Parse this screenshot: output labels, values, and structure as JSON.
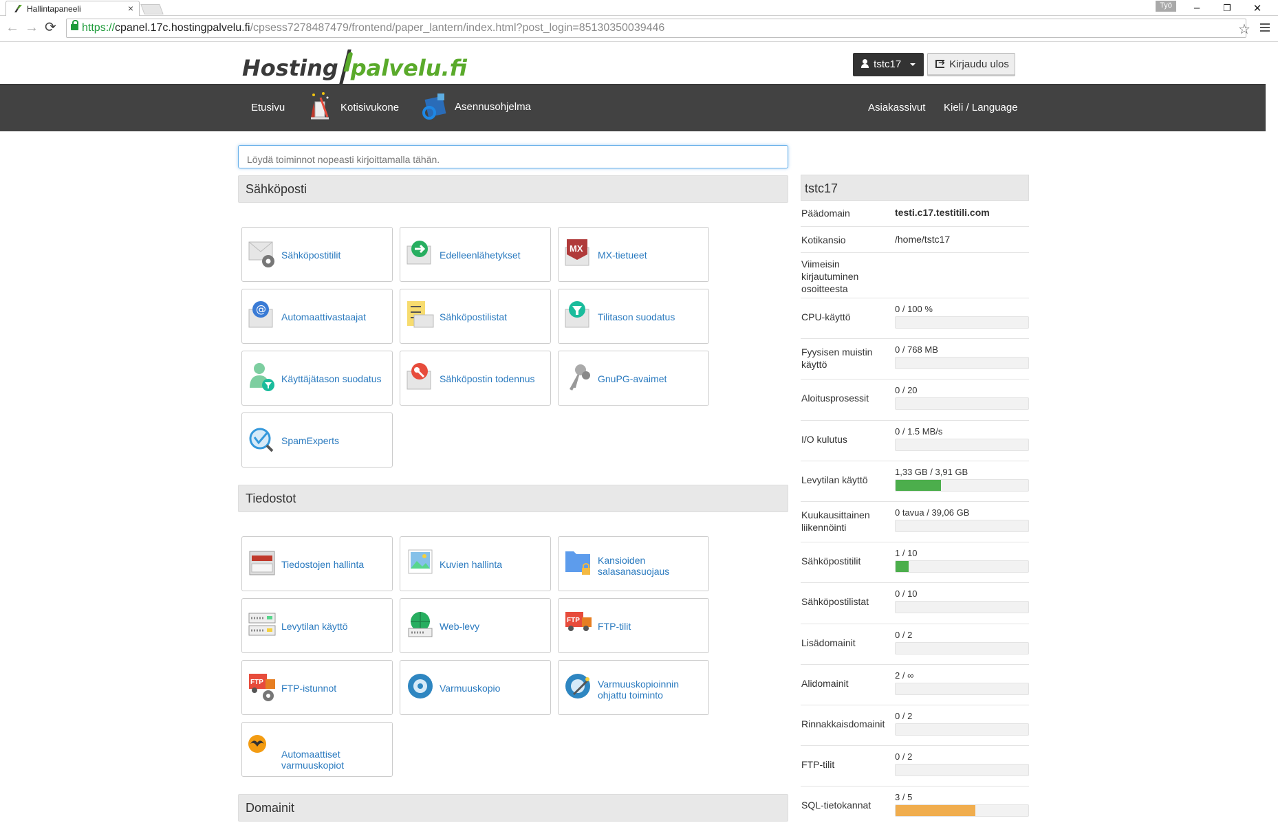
{
  "browser": {
    "tab_title": "Hallintapaneeli",
    "tab_close": "×",
    "window_badge": "Työ",
    "url_scheme": "https://",
    "url_host": "cpanel.17c.hostingpalvelu.fi",
    "url_path": "/cpsess7278487479/frontend/paper_lantern/index.html?post_login=85130350039446",
    "back": "←",
    "forward": "→",
    "reload": "⟳",
    "star": "☆",
    "minimize": "–",
    "restore": "❐",
    "close": "✕"
  },
  "header": {
    "logo_part1": "Hosting",
    "logo_part2": "palvelu.fi",
    "user_label": "tstc17",
    "logout_label": "Kirjaudu ulos"
  },
  "nav": {
    "home": "Etusivu",
    "site_builder": "Kotisivukone",
    "installer": "Asennusohjelma",
    "customer_pages": "Asiakassivut",
    "language": "Kieli / Language"
  },
  "search": {
    "placeholder": "Löydä toiminnot nopeasti kirjoittamalla tähän."
  },
  "sections": {
    "email": {
      "title": "Sähköposti",
      "items": [
        {
          "label": "Sähköpostitilit",
          "icon": "email-accounts-icon"
        },
        {
          "label": "Edelleenlähetykset",
          "icon": "forwarders-icon"
        },
        {
          "label": "MX-tietueet",
          "icon": "mx-records-icon"
        },
        {
          "label": "Automaattivastaajat",
          "icon": "autoresponders-icon"
        },
        {
          "label": "Sähköpostilistat",
          "icon": "mailing-lists-icon"
        },
        {
          "label": "Tilitason suodatus",
          "icon": "account-filter-icon"
        },
        {
          "label": "Käyttäjätason suodatus",
          "icon": "user-filter-icon"
        },
        {
          "label": "Sähköpostin todennus",
          "icon": "email-auth-icon"
        },
        {
          "label": "GnuPG-avaimet",
          "icon": "gnupg-keys-icon"
        },
        {
          "label": "SpamExperts",
          "icon": "spamexperts-icon"
        }
      ]
    },
    "files": {
      "title": "Tiedostot",
      "items": [
        {
          "label": "Tiedostojen hallinta",
          "icon": "file-manager-icon"
        },
        {
          "label": "Kuvien hallinta",
          "icon": "images-icon"
        },
        {
          "label": "Kansioiden",
          "label2": "salasanasuojaus",
          "icon": "folder-lock-icon"
        },
        {
          "label": "Levytilan käyttö",
          "icon": "disk-usage-icon"
        },
        {
          "label": "Web-levy",
          "icon": "web-disk-icon"
        },
        {
          "label": "FTP-tilit",
          "icon": "ftp-accounts-icon"
        },
        {
          "label": "FTP-istunnot",
          "icon": "ftp-sessions-icon"
        },
        {
          "label": "Varmuuskopio",
          "icon": "backup-icon"
        },
        {
          "label": "Varmuuskopioinnin",
          "label2": "ohjattu toiminto",
          "icon": "backup-wizard-icon"
        },
        {
          "label": "Automaattiset",
          "label2": "varmuuskopiot",
          "icon": "auto-backup-icon"
        }
      ]
    },
    "domains": {
      "title": "Domainit"
    }
  },
  "sidebar": {
    "title": "tstc17",
    "info": [
      {
        "key": "Päädomain",
        "value": "testi.c17.testitili.com"
      },
      {
        "key": "Kotikansio",
        "value": "/home/tstc17"
      },
      {
        "key": "Viimeisin",
        "key2": "kirjautuminen",
        "key3": "osoitteesta",
        "value": ""
      }
    ],
    "stats": [
      {
        "key": "CPU-käyttö",
        "value": "0 / 100 %",
        "percent": 0
      },
      {
        "key": "Fyysisen muistin",
        "key2": "käyttö",
        "value": "0 / 768 MB",
        "percent": 0
      },
      {
        "key": "Aloitusprosessit",
        "value": "0 / 20",
        "percent": 0
      },
      {
        "key": "I/O kulutus",
        "value": "0 / 1.5 MB/s",
        "percent": 0
      },
      {
        "key": "Levytilan käyttö",
        "value": "1,33 GB / 3,91 GB",
        "percent": 34
      },
      {
        "key": "Kuukausittainen",
        "key2": "liikennöinti",
        "value": "0 tavua / 39,06 GB",
        "percent": 0
      },
      {
        "key": "Sähköpostitilit",
        "value": "1 / 10",
        "percent": 10
      },
      {
        "key": "Sähköpostilistat",
        "value": "0 / 10",
        "percent": 0
      },
      {
        "key": "Lisädomainit",
        "value": "0 / 2",
        "percent": 0
      },
      {
        "key": "Alidomainit",
        "value": "2 / ∞",
        "percent": 0
      },
      {
        "key": "Rinnakkaisdomainit",
        "value": "0 / 2",
        "percent": 0
      },
      {
        "key": "FTP-tilit",
        "value": "0 / 2",
        "percent": 0
      },
      {
        "key": "SQL-tietokannat",
        "value": "3 / 5",
        "percent": 60
      }
    ]
  },
  "colors": {
    "link": "#2a7abf",
    "navbar": "#424242",
    "bar_ok": "#4cae4c",
    "bar_warn": "#f0ad4e",
    "logo_green": "#5aaa2b"
  }
}
